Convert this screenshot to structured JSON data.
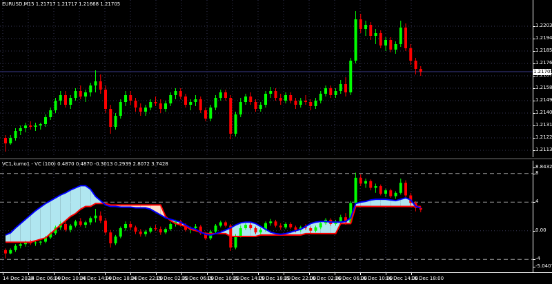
{
  "main": {
    "title": "EURUSD,M15  1.21717 1.21717 1.21668 1.21705",
    "current_price": "1.21705",
    "y_ticks": [
      "1.22030",
      "1.21940",
      "1.21850",
      "1.21760",
      "1.21670",
      "1.21580",
      "1.21490",
      "1.21400",
      "1.21310",
      "1.21220",
      "1.21130"
    ],
    "y_range": [
      1.2111,
      1.2218
    ],
    "candles": [
      [
        1.2122,
        1.2124,
        1.2112,
        1.2118
      ],
      [
        1.2118,
        1.2124,
        1.2117,
        1.2122
      ],
      [
        1.2122,
        1.2129,
        1.212,
        1.2127
      ],
      [
        1.2127,
        1.2131,
        1.2124,
        1.2129
      ],
      [
        1.2129,
        1.2133,
        1.2126,
        1.2131
      ],
      [
        1.2131,
        1.2134,
        1.2128,
        1.213
      ],
      [
        1.213,
        1.2133,
        1.2127,
        1.2131
      ],
      [
        1.2131,
        1.2133,
        1.2128,
        1.2132
      ],
      [
        1.2132,
        1.2139,
        1.213,
        1.2137
      ],
      [
        1.2137,
        1.2144,
        1.2135,
        1.2142
      ],
      [
        1.2142,
        1.2151,
        1.214,
        1.2149
      ],
      [
        1.2149,
        1.2156,
        1.2146,
        1.2153
      ],
      [
        1.2153,
        1.2156,
        1.2144,
        1.2146
      ],
      [
        1.2146,
        1.2153,
        1.2143,
        1.2151
      ],
      [
        1.2151,
        1.2158,
        1.2149,
        1.2156
      ],
      [
        1.2156,
        1.216,
        1.215,
        1.2152
      ],
      [
        1.2152,
        1.2157,
        1.2148,
        1.2155
      ],
      [
        1.2155,
        1.2162,
        1.2152,
        1.216
      ],
      [
        1.216,
        1.2171,
        1.2155,
        1.2163
      ],
      [
        1.2163,
        1.2168,
        1.2154,
        1.2157
      ],
      [
        1.2157,
        1.216,
        1.214,
        1.2143
      ],
      [
        1.2143,
        1.2146,
        1.2125,
        1.213
      ],
      [
        1.213,
        1.214,
        1.2128,
        1.2138
      ],
      [
        1.2138,
        1.215,
        1.2136,
        1.2148
      ],
      [
        1.2148,
        1.2156,
        1.2145,
        1.2153
      ],
      [
        1.2153,
        1.2156,
        1.2146,
        1.2149
      ],
      [
        1.2149,
        1.2151,
        1.2141,
        1.2144
      ],
      [
        1.2144,
        1.2147,
        1.2138,
        1.2141
      ],
      [
        1.2141,
        1.2146,
        1.2138,
        1.2144
      ],
      [
        1.2144,
        1.215,
        1.2142,
        1.2148
      ],
      [
        1.2148,
        1.2152,
        1.2145,
        1.2147
      ],
      [
        1.2147,
        1.215,
        1.214,
        1.2143
      ],
      [
        1.2143,
        1.2149,
        1.2141,
        1.2147
      ],
      [
        1.2147,
        1.2155,
        1.2145,
        1.2153
      ],
      [
        1.2153,
        1.2158,
        1.215,
        1.2156
      ],
      [
        1.2156,
        1.2158,
        1.215,
        1.2152
      ],
      [
        1.2152,
        1.2154,
        1.2144,
        1.2146
      ],
      [
        1.2146,
        1.215,
        1.2142,
        1.2148
      ],
      [
        1.2148,
        1.2153,
        1.2145,
        1.215
      ],
      [
        1.215,
        1.2152,
        1.214,
        1.2142
      ],
      [
        1.2142,
        1.2144,
        1.2134,
        1.2136
      ],
      [
        1.2136,
        1.2146,
        1.2134,
        1.2144
      ],
      [
        1.2144,
        1.2153,
        1.2142,
        1.2151
      ],
      [
        1.2151,
        1.2157,
        1.2149,
        1.2155
      ],
      [
        1.2155,
        1.2157,
        1.2149,
        1.2151
      ],
      [
        1.2151,
        1.2153,
        1.2121,
        1.2125
      ],
      [
        1.2125,
        1.2141,
        1.2123,
        1.2139
      ],
      [
        1.2139,
        1.2151,
        1.2137,
        1.2148
      ],
      [
        1.2148,
        1.2154,
        1.2146,
        1.2152
      ],
      [
        1.2152,
        1.2155,
        1.2146,
        1.2148
      ],
      [
        1.2148,
        1.215,
        1.2141,
        1.2143
      ],
      [
        1.2143,
        1.2148,
        1.2141,
        1.2146
      ],
      [
        1.2146,
        1.2156,
        1.2144,
        1.2154
      ],
      [
        1.2154,
        1.2159,
        1.2151,
        1.2156
      ],
      [
        1.2156,
        1.2158,
        1.2149,
        1.2151
      ],
      [
        1.2151,
        1.2154,
        1.2146,
        1.2149
      ],
      [
        1.2149,
        1.2155,
        1.2147,
        1.2153
      ],
      [
        1.2153,
        1.2155,
        1.2147,
        1.2149
      ],
      [
        1.2149,
        1.2151,
        1.2143,
        1.2146
      ],
      [
        1.2146,
        1.2151,
        1.2144,
        1.2149
      ],
      [
        1.2149,
        1.2153,
        1.2146,
        1.2148
      ],
      [
        1.2148,
        1.215,
        1.2142,
        1.2145
      ],
      [
        1.2145,
        1.2151,
        1.2143,
        1.2149
      ],
      [
        1.2149,
        1.2156,
        1.2147,
        1.2154
      ],
      [
        1.2154,
        1.216,
        1.2152,
        1.2158
      ],
      [
        1.2158,
        1.216,
        1.2151,
        1.2153
      ],
      [
        1.2153,
        1.2158,
        1.2151,
        1.2156
      ],
      [
        1.2156,
        1.2164,
        1.2154,
        1.2161
      ],
      [
        1.2161,
        1.2166,
        1.2152,
        1.2155
      ],
      [
        1.2155,
        1.218,
        1.2153,
        1.2178
      ],
      [
        1.2178,
        1.2214,
        1.2176,
        1.2208
      ],
      [
        1.2208,
        1.2212,
        1.2198,
        1.2201
      ],
      [
        1.2201,
        1.2207,
        1.2196,
        1.2204
      ],
      [
        1.2204,
        1.2206,
        1.2193,
        1.2196
      ],
      [
        1.2196,
        1.2201,
        1.219,
        1.2198
      ],
      [
        1.2198,
        1.22,
        1.2187,
        1.2189
      ],
      [
        1.2189,
        1.2195,
        1.2185,
        1.2193
      ],
      [
        1.2193,
        1.2195,
        1.2184,
        1.2186
      ],
      [
        1.2186,
        1.2192,
        1.2183,
        1.219
      ],
      [
        1.219,
        1.2207,
        1.2188,
        1.2202
      ],
      [
        1.2202,
        1.2205,
        1.2185,
        1.2187
      ],
      [
        1.2187,
        1.219,
        1.2175,
        1.2178
      ],
      [
        1.2178,
        1.218,
        1.2168,
        1.2172
      ],
      [
        1.2172,
        1.2174,
        1.2167,
        1.217
      ]
    ]
  },
  "sub": {
    "title": "VC1,kumo1 - VC (100) 0.4870 0.4870 -0.3013 0.2939 2.8072 3.7428",
    "y_ticks": [
      "8.8432",
      "8",
      "4",
      "0.00",
      "-4",
      "-5.0407"
    ],
    "y_range": [
      -5.0407,
      8.8432
    ],
    "levels": [
      8,
      4,
      -4
    ],
    "spans": {
      "a": [
        -0.6,
        -0.3,
        0.4,
        1.0,
        1.6,
        2.2,
        2.8,
        3.3,
        3.8,
        4.2,
        4.6,
        5.0,
        5.3,
        5.7,
        6.0,
        6.3,
        6.3,
        5.8,
        4.8,
        4.2,
        3.6,
        3.4,
        3.4,
        3.3,
        3.3,
        3.3,
        3.2,
        3.2,
        3.2,
        3.0,
        2.6,
        2.2,
        1.8,
        1.6,
        1.4,
        1.2,
        0.8,
        0.4,
        0.2,
        -0.2,
        -0.5,
        -0.6,
        -0.4,
        -0.2,
        0.1,
        0.4,
        0.8,
        1.1,
        1.2,
        1.2,
        1.0,
        0.6,
        0.2,
        -0.2,
        -0.4,
        -0.5,
        -0.4,
        -0.2,
        0.0,
        0.2,
        0.6,
        1.0,
        1.2,
        1.3,
        1.3,
        1.2,
        1.2,
        1.2,
        1.3,
        1.8,
        3.8,
        4.0,
        4.1,
        4.3,
        4.4,
        4.4,
        4.4,
        4.3,
        4.2,
        4.4,
        4.6,
        4.3,
        3.4,
        3.2
      ],
      "b": [
        -1.6,
        -1.6,
        -1.6,
        -1.6,
        -1.6,
        -1.6,
        -1.4,
        -1.2,
        -1.0,
        -0.4,
        0.2,
        0.8,
        1.4,
        2.0,
        2.4,
        3.0,
        3.4,
        3.4,
        3.8,
        3.8,
        3.8,
        3.6,
        3.6,
        3.6,
        3.6,
        3.6,
        3.6,
        3.6,
        3.6,
        3.6,
        3.6,
        3.6,
        2.0,
        1.4,
        1.0,
        0.8,
        0.6,
        0.2,
        0.0,
        -0.2,
        -0.4,
        -0.4,
        -0.4,
        -0.4,
        -0.4,
        -0.8,
        -0.8,
        -0.8,
        -0.8,
        -0.8,
        -0.8,
        -0.6,
        -0.6,
        -0.6,
        -0.6,
        -0.6,
        -0.6,
        -0.6,
        -0.6,
        -0.6,
        -0.4,
        -0.4,
        -0.4,
        -0.4,
        -0.4,
        -0.4,
        -0.4,
        1.0,
        1.0,
        1.0,
        3.4,
        3.4,
        3.4,
        3.4,
        3.4,
        3.4,
        3.4,
        3.4,
        3.4,
        3.4,
        3.4,
        3.4,
        3.4,
        3.4
      ]
    }
  },
  "time_labels": [
    "14 Dec 2020",
    "14 Dec 06:00",
    "14 Dec 10:00",
    "14 Dec 14:00",
    "14 Dec 18:00",
    "14 Dec 22:00",
    "15 Dec 02:00",
    "15 Dec 06:00",
    "15 Dec 10:00",
    "15 Dec 14:00",
    "15 Dec 18:00",
    "15 Dec 22:00",
    "16 Dec 02:00",
    "16 Dec 06:00",
    "16 Dec 10:00",
    "16 Dec 14:00",
    "16 Dec 18:00"
  ],
  "colors": {
    "background": "#000000",
    "bull": "#00ff00",
    "bear": "#ff0000",
    "grid": "#3a3a5a",
    "kumo_up": "#b0e6f0",
    "kumo_down": "#ffdfc8",
    "span_a": "#0000ff",
    "span_b": "#ff0000",
    "price_line": "#3a3a8a"
  }
}
